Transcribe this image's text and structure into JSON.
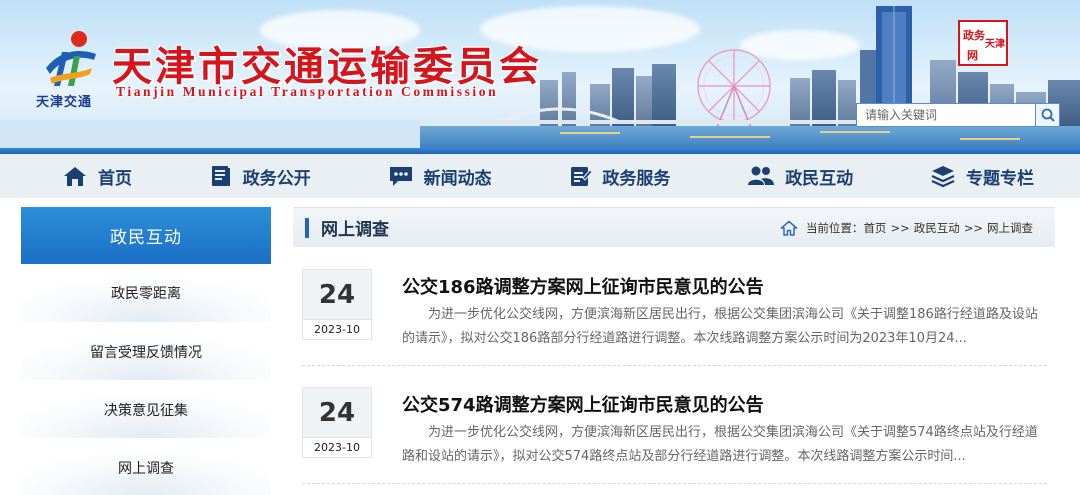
{
  "header": {
    "logo_caption": "天津交通",
    "title": "天津市交通运输委员会",
    "subtitle": "Tianjin Municipal Transportation Commission",
    "seal_text": [
      "政务",
      "天津",
      "网"
    ],
    "search": {
      "placeholder": "请输入关键词",
      "value": ""
    }
  },
  "nav": {
    "items": [
      {
        "label": "首页",
        "icon": "home-icon"
      },
      {
        "label": "政务公开",
        "icon": "document-icon"
      },
      {
        "label": "新闻动态",
        "icon": "chat-icon"
      },
      {
        "label": "政务服务",
        "icon": "clipboard-icon"
      },
      {
        "label": "政民互动",
        "icon": "users-icon"
      },
      {
        "label": "专题专栏",
        "icon": "layers-icon"
      }
    ]
  },
  "sidebar": {
    "title": "政民互动",
    "items": [
      {
        "label": "政民零距离"
      },
      {
        "label": "留言受理反馈情况"
      },
      {
        "label": "决策意见征集"
      },
      {
        "label": "网上调查"
      }
    ]
  },
  "main": {
    "title": "网上调查",
    "breadcrumb": {
      "prefix": "当前位置：",
      "items": [
        "首页",
        "政民互动",
        "网上调查"
      ],
      "separator": ">>"
    },
    "articles": [
      {
        "day": "24",
        "year_month": "2023-10",
        "title": "公交186路调整方案网上征询市民意见的公告",
        "summary": "为进一步优化公交线网，方便滨海新区居民出行，根据公交集团滨海公司《关于调整186路行经道路及设站的请示》，拟对公交186路部分行经道路进行调整。本次线路调整方案公示时间为2023年10月24..."
      },
      {
        "day": "24",
        "year_month": "2023-10",
        "title": "公交574路调整方案网上征询市民意见的公告",
        "summary": "为进一步优化公交线网，方便滨海新区居民出行，根据公交集团滨海公司《关于调整574路终点站及行经道路和设站的请示》，拟对公交574路终点站及部分行经道路进行调整。本次线路调整方案公示时间..."
      }
    ]
  },
  "colors": {
    "brand_red": "#d6141b",
    "nav_blue": "#1d62b8",
    "nav_text": "#1c3f73",
    "sidebar_head": "#1b6fc6"
  }
}
